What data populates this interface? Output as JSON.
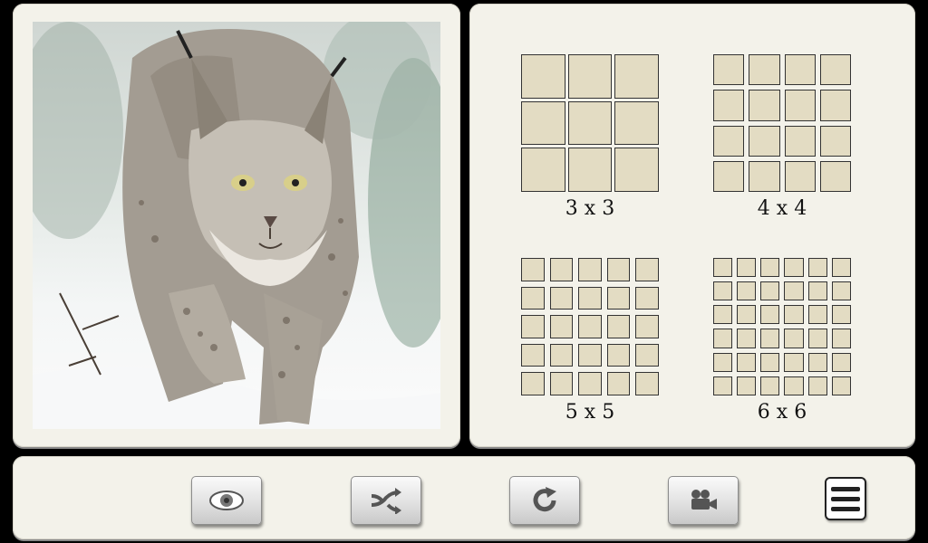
{
  "photo": {
    "subject": "lynx-photo"
  },
  "grid_options": [
    {
      "label": "3 x 3",
      "size": 3
    },
    {
      "label": "4 x 4",
      "size": 4
    },
    {
      "label": "5 x 5",
      "size": 5
    },
    {
      "label": "6 x 6",
      "size": 6
    }
  ],
  "toolbar": {
    "buttons": [
      {
        "icon": "eye-icon"
      },
      {
        "icon": "shuffle-arrows-icon"
      },
      {
        "icon": "rotate-icon"
      },
      {
        "icon": "video-camera-icon"
      },
      {
        "icon": "menu-icon"
      }
    ]
  },
  "colors": {
    "panel": "#f3f2ea",
    "tile": "#e3dcc3",
    "background": "#000000"
  }
}
